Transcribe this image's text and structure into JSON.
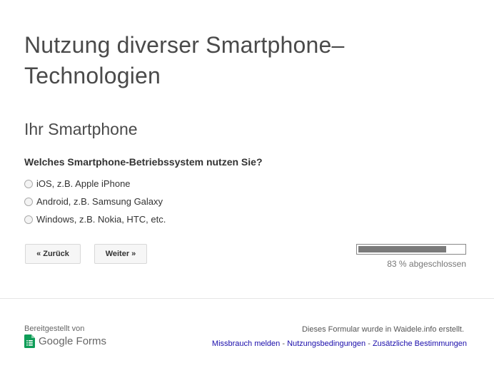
{
  "form": {
    "title": "Nutzung diverser Smartphone–Technologien",
    "section_title": "Ihr Smartphone",
    "question": "Welches Smartphone-Betriebssystem nutzen Sie?",
    "options": [
      "iOS, z.B. Apple iPhone",
      "Android, z.B. Samsung Galaxy",
      "Windows, z.B. Nokia, HTC, etc."
    ],
    "back_label": "« Zurück",
    "next_label": "Weiter »",
    "progress_percent": 83,
    "progress_label": "83 % abgeschlossen"
  },
  "footer": {
    "powered_by": "Bereitgestellt von",
    "brand_name": "Google",
    "brand_product": "Forms",
    "created_text": "Dieses Formular wurde in Waidele.info erstellt.",
    "links": [
      "Missbrauch melden",
      "Nutzungsbedingungen",
      "Zusätzliche Bestimmungen"
    ],
    "link_separator": " - "
  },
  "colors": {
    "link": "#1a0dab",
    "progress_fill": "#7a7a7a",
    "forms_green": "#0f9d58"
  },
  "icons": {
    "forms_logo": "google-forms-icon"
  }
}
